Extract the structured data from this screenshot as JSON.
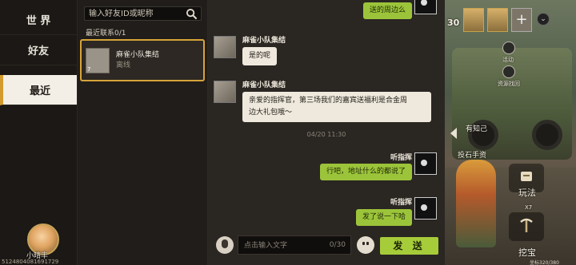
{
  "nav": {
    "items": [
      {
        "label": "世 界"
      },
      {
        "label": "好友"
      },
      {
        "label": "最近"
      }
    ]
  },
  "profile": {
    "name": "小晴丰",
    "id_text": "5124804081691729"
  },
  "contacts": {
    "search_placeholder": "输入好友ID或昵称",
    "recent_label": "最近联系0/1",
    "list": [
      {
        "name": "麻雀小队集结",
        "status": "离线",
        "level": "7"
      }
    ]
  },
  "chat": {
    "messages": [
      {
        "side": "out",
        "text": "送的周边么"
      },
      {
        "side": "in",
        "sender": "麻雀小队集结",
        "text": "是的呢"
      },
      {
        "side": "in",
        "sender": "麻雀小队集结",
        "text_line1": "亲爱的指挥官，第三场我们的嘉宾送福利是合金周",
        "text_line2": "边大礼包哦～"
      },
      {
        "side": "out",
        "sender": "听指挥",
        "text": "行吧，地址什么的都说了"
      },
      {
        "side": "out",
        "sender": "听指挥",
        "text": "发了说一下哈"
      }
    ],
    "timestamp": "04/20 11:30",
    "input_placeholder": "点击输入文字",
    "char_counter": "0/30",
    "send_label": "发 送"
  },
  "hud": {
    "number_left": "30",
    "activity_label": "活动",
    "resource_label": "资源找回",
    "acquired_label": "有知己",
    "stamp_label": "投石手资",
    "play_label": "玩法",
    "count_label": "X7",
    "dig_label": "挖宝",
    "coord_text": "坐标320/380"
  },
  "colors": {
    "accent_gold": "#d7a43a",
    "send_green": "#a6cc3a",
    "bubble_out": "#9cc43a",
    "bubble_in": "#efe9dd"
  }
}
